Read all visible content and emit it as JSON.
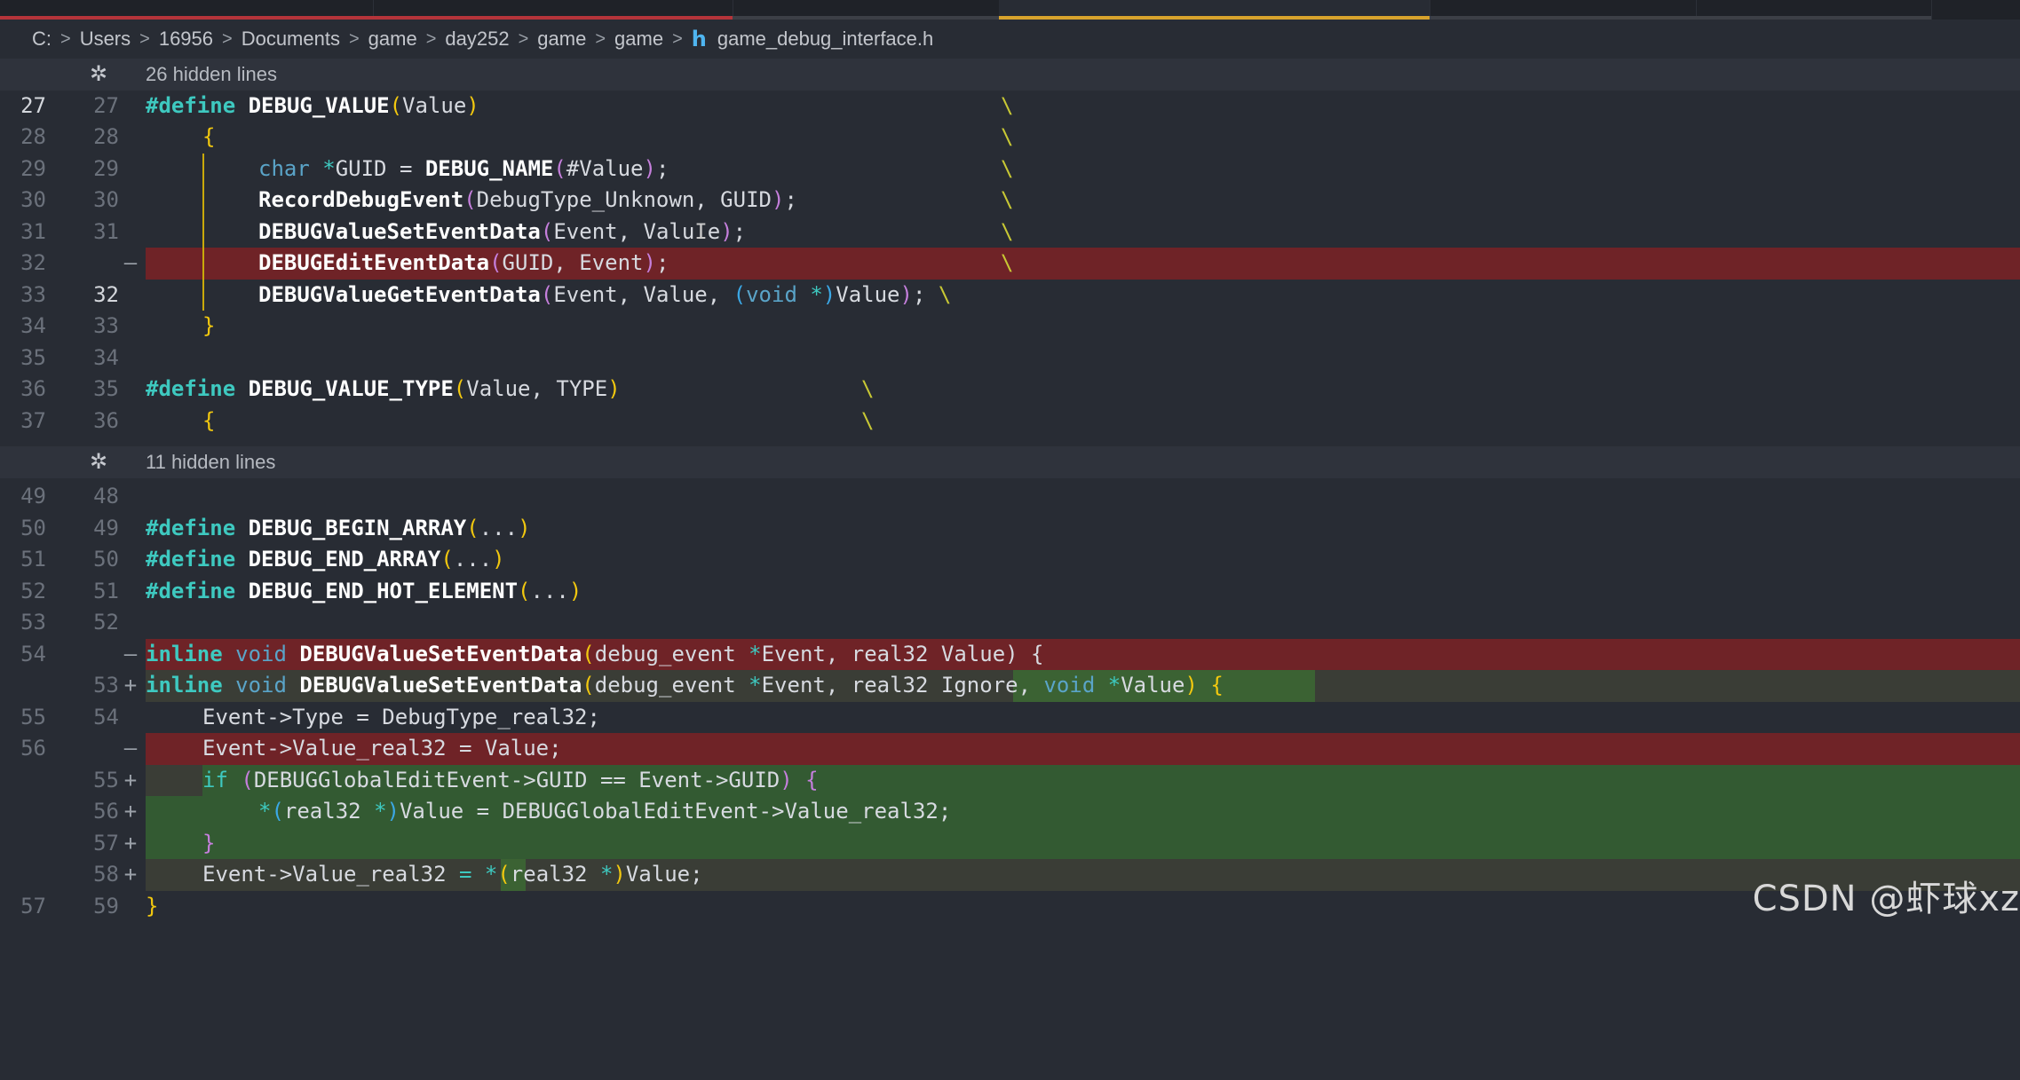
{
  "breadcrumb": {
    "items": [
      "C:",
      "Users",
      "16956",
      "Documents",
      "game",
      "day252",
      "game",
      "game"
    ],
    "file_icon": "h",
    "file_name": "game_debug_interface.h",
    "separator": ">"
  },
  "folds": [
    {
      "label": "26 hidden lines"
    },
    {
      "label": "11 hidden lines"
    }
  ],
  "lines": [
    {
      "old": "27",
      "new": "27"
    },
    {
      "old": "28",
      "new": "28"
    },
    {
      "old": "29",
      "new": "29"
    },
    {
      "old": "30",
      "new": "30"
    },
    {
      "old": "31",
      "new": "31"
    },
    {
      "old": "32",
      "new": "",
      "mark": "—"
    },
    {
      "old": "33",
      "new": "32"
    },
    {
      "old": "34",
      "new": "33"
    },
    {
      "old": "35",
      "new": "34"
    },
    {
      "old": "36",
      "new": "35"
    },
    {
      "old": "37",
      "new": "36"
    },
    {
      "old": "49",
      "new": "48"
    },
    {
      "old": "50",
      "new": "49"
    },
    {
      "old": "51",
      "new": "50"
    },
    {
      "old": "52",
      "new": "51"
    },
    {
      "old": "53",
      "new": "52"
    },
    {
      "old": "54",
      "new": "",
      "mark": "—"
    },
    {
      "old": "",
      "new": "53",
      "mark": "+"
    },
    {
      "old": "55",
      "new": "54"
    },
    {
      "old": "56",
      "new": "",
      "mark": "—"
    },
    {
      "old": "",
      "new": "55",
      "mark": "+"
    },
    {
      "old": "",
      "new": "56",
      "mark": "+"
    },
    {
      "old": "",
      "new": "57",
      "mark": "+"
    },
    {
      "old": "",
      "new": "58",
      "mark": "+"
    },
    {
      "old": "57",
      "new": "59"
    }
  ],
  "code": {
    "define": "#define",
    "backslash": "\\",
    "l27_name": "DEBUG_VALUE",
    "l27_arg": "Value",
    "open_brace": "{",
    "close_brace": "}",
    "l29_type": "char",
    "l29_star": "*",
    "l29_var": "GUID = ",
    "l29_fn": "DEBUG_NAME",
    "l29_arg": "#Value",
    "l29_end": ";",
    "l30_fn": "RecordDebugEvent",
    "l30_args": "DebugType_Unknown, GUID",
    "l31_fn": "DEBUGValueSetEventData",
    "l31_args_a": "Event, Valu",
    "l31_cursor": "I",
    "l31_args_b": "e",
    "l32_fn": "DEBUGEditEventData",
    "l32_args": "GUID, Event",
    "l33_fn": "DEBUGValueGetEventData",
    "l33_args": "Event, Value, ",
    "void": "void",
    "star": "*",
    "value": "Value",
    "semicolon": ";",
    "l36_name": "DEBUG_VALUE_TYPE",
    "l36_args": "Value, TYPE",
    "l50_name": "DEBUG_BEGIN_ARRAY",
    "l51_name": "DEBUG_END_ARRAY",
    "l52_name": "DEBUG_END_HOT_ELEMENT",
    "ellipsis": "...",
    "inline": "inline",
    "set_fn": "DEBUGValueSetEventData",
    "debug_event": "debug_event ",
    "event_param": "Event, real32 ",
    "old_tail": "Value) {",
    "ignore": "Ignore, ",
    "value_paren": "Value",
    "l55_text": "Event->Type = DebugType_real32;",
    "l56_text": "Event->Value_real32 = Value;",
    "if": "if",
    "if_cond": "DEBUGGlobalEditEvent->GUID == Event->GUID",
    "deref_type": "real32 ",
    "deref_rhs": "Value = DEBUGGlobalEditEvent->Value_real32;",
    "l58_lhs": "Event->Value_real32 ",
    "eq": "=",
    "l58_cast": "real32 ",
    "l58_tail": "Value;"
  },
  "watermark": "CSDN @虾球xz",
  "colors": {
    "background": "#282c34",
    "deleted": "#8c2424",
    "added": "#2f6b2a",
    "keyword": "#3ec9c0",
    "bracket_gold": "#f2c80f",
    "bracket_purple": "#c57fdc",
    "bracket_blue": "#3ba8e6"
  },
  "icons": {
    "fold": "unfold-icon",
    "file": "c-header-file-icon"
  }
}
